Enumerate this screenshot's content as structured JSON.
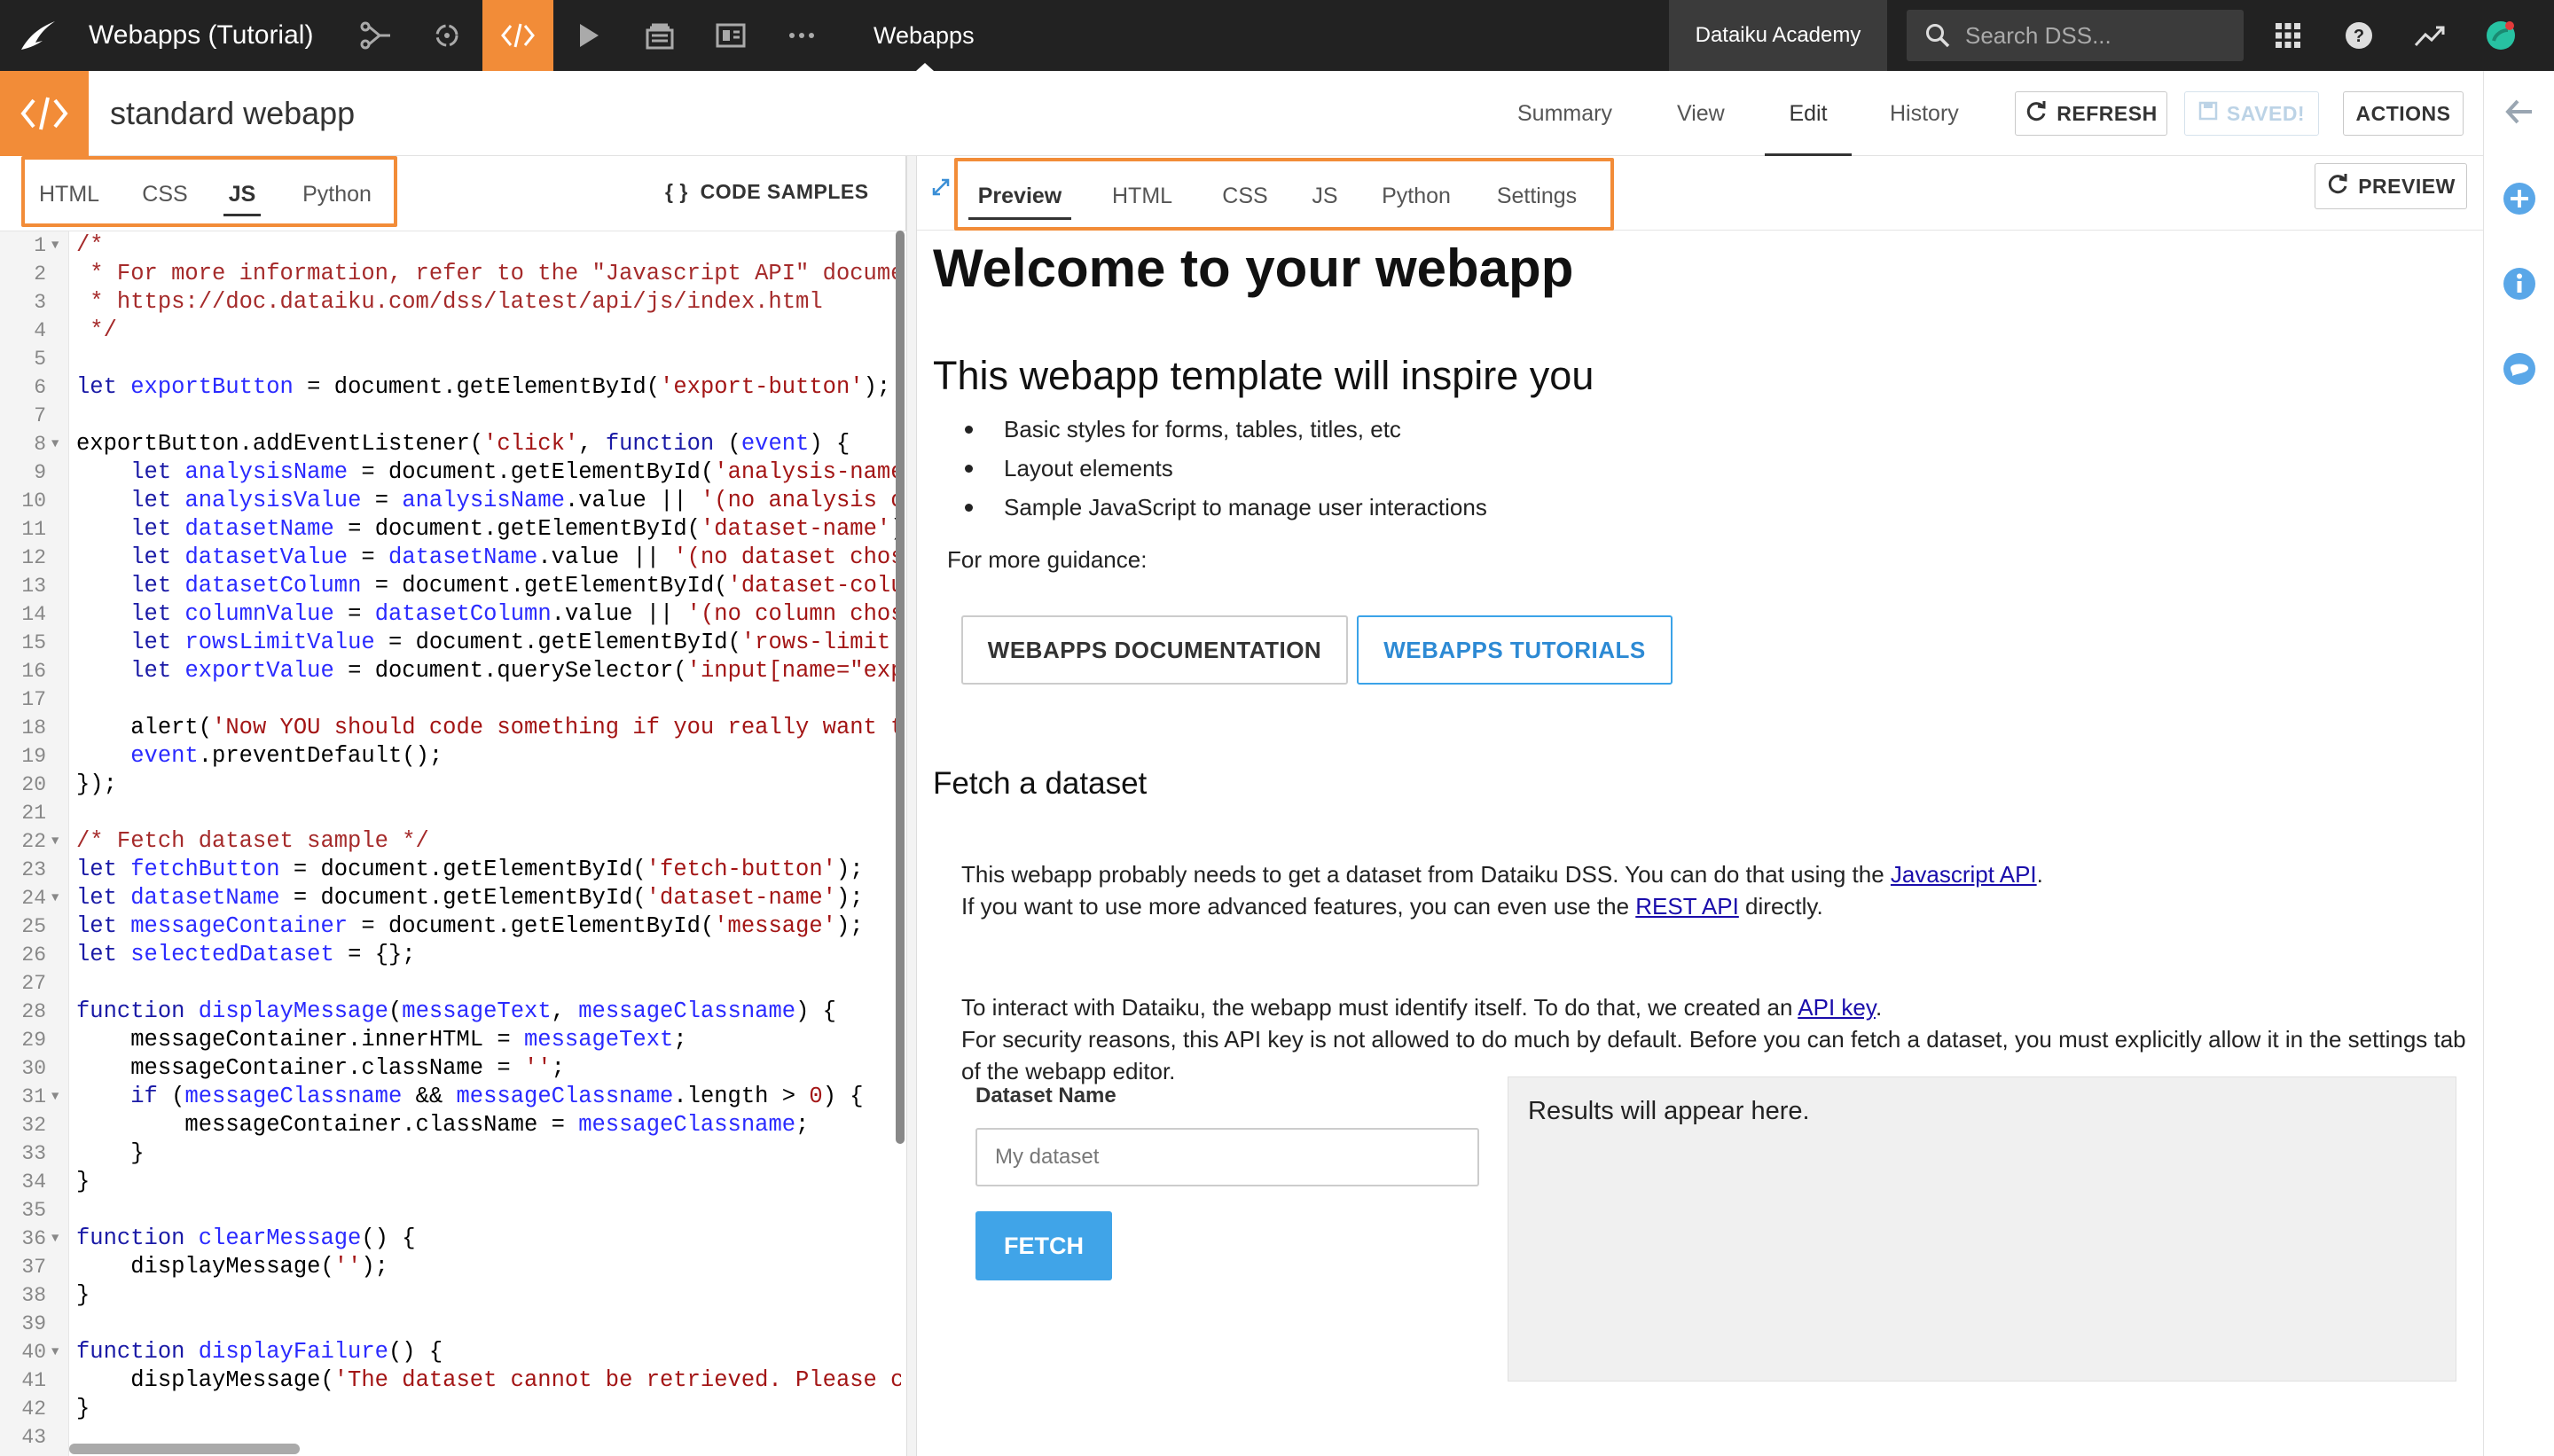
{
  "topbar": {
    "project_title": "Webapps (Tutorial)",
    "breadcrumb": "Webapps",
    "academy": "Dataiku Academy",
    "search_placeholder": "Search DSS..."
  },
  "header": {
    "title": "standard webapp",
    "tabs": [
      "Summary",
      "View",
      "Edit",
      "History"
    ],
    "active_tab": "Edit",
    "refresh_label": "REFRESH",
    "saved_label": "SAVED!",
    "actions_label": "ACTIONS"
  },
  "code_panel": {
    "tabs": [
      "HTML",
      "CSS",
      "JS",
      "Python"
    ],
    "active_tab": "JS",
    "code_samples_label": "CODE SAMPLES",
    "line_numbers": [
      "1",
      "2",
      "3",
      "4",
      "5",
      "6",
      "7",
      "8",
      "9",
      "10",
      "11",
      "12",
      "13",
      "14",
      "15",
      "16",
      "17",
      "18",
      "19",
      "20",
      "21",
      "22",
      "23",
      "24",
      "25",
      "26",
      "27",
      "28",
      "29",
      "30",
      "31",
      "32",
      "33",
      "34",
      "35",
      "36",
      "37",
      "38",
      "39",
      "40",
      "41",
      "42",
      "43"
    ]
  },
  "preview_panel": {
    "tabs": [
      "Preview",
      "HTML",
      "CSS",
      "JS",
      "Python",
      "Settings"
    ],
    "active_tab": "Preview",
    "preview_button": "PREVIEW"
  },
  "webapp": {
    "h1": "Welcome to your webapp",
    "h2": "This webapp template will inspire you",
    "bullets": [
      "Basic styles for forms, tables, titles, etc",
      "Layout elements",
      "Sample JavaScript to manage user interactions"
    ],
    "guidance": "For more guidance:",
    "doc_button": "WEBAPPS DOCUMENTATION",
    "tutorial_button": "WEBAPPS TUTORIALS",
    "h3": "Fetch a dataset",
    "p1a": "This webapp probably needs to get a dataset from Dataiku DSS. You can do that using the ",
    "p1_link": "Javascript API",
    "p1b": ".",
    "p2a": "If you want to use more advanced features, you can even use the ",
    "p2_link": "REST API",
    "p2b": " directly.",
    "p3a": "To interact with Dataiku, the webapp must identify itself. To do that, we created an ",
    "p3_link": "API key",
    "p3b": ".",
    "p4": "For security reasons, this API key is not allowed to do much by default. Before you can fetch a dataset, you must explicitly allow it in the settings tab of the webapp editor.",
    "dataset_label": "Dataset Name",
    "dataset_placeholder": "My dataset",
    "fetch_button": "FETCH",
    "results_text": "Results will appear here."
  },
  "colors": {
    "accent": "#f28c38",
    "topbar_bg": "#222222",
    "link_blue": "#2d8ad4",
    "fetch_blue": "#40a4e8"
  }
}
